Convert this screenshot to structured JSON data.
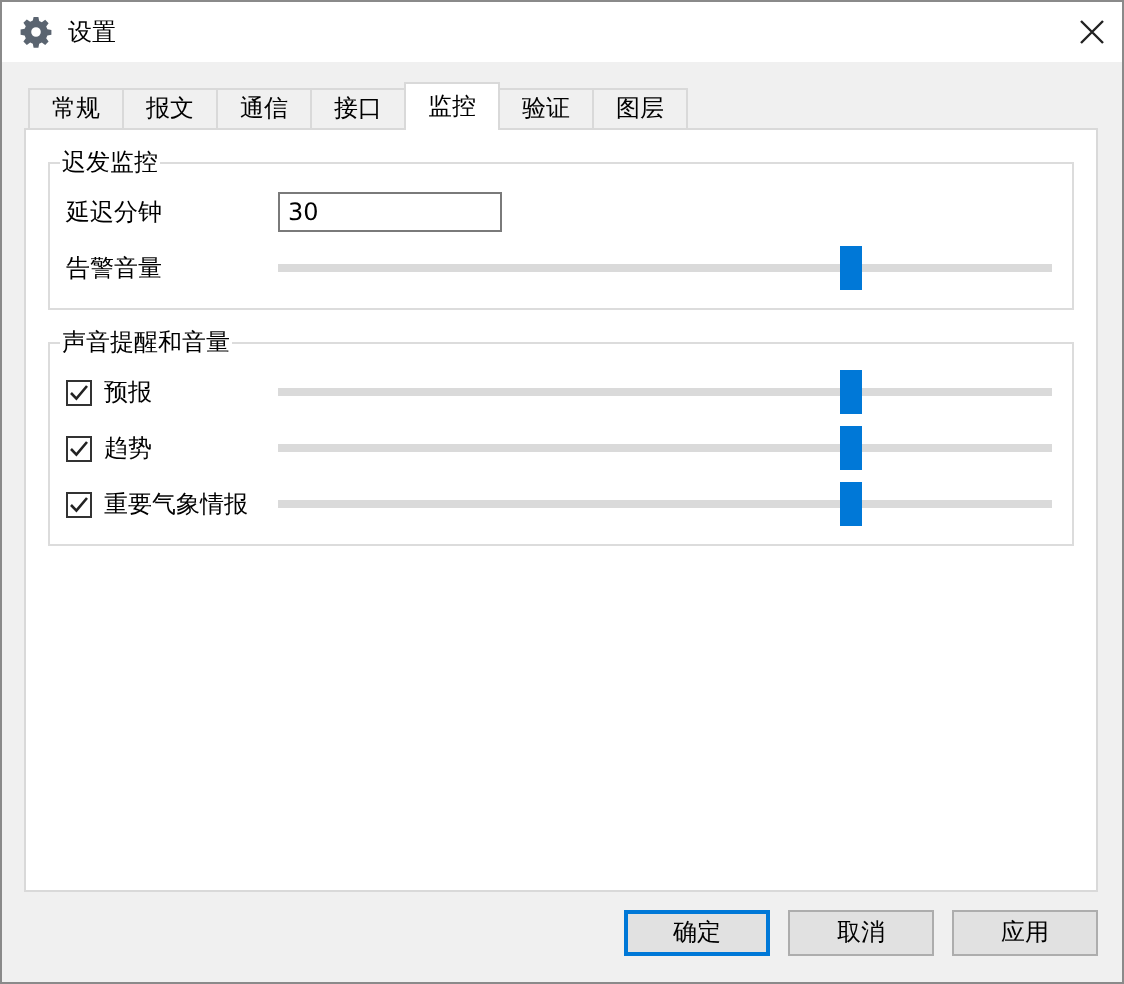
{
  "window": {
    "title": "设置"
  },
  "tabs": [
    {
      "label": "常规",
      "selected": false
    },
    {
      "label": "报文",
      "selected": false
    },
    {
      "label": "通信",
      "selected": false
    },
    {
      "label": "接口",
      "selected": false
    },
    {
      "label": "监控",
      "selected": true
    },
    {
      "label": "验证",
      "selected": false
    },
    {
      "label": "图层",
      "selected": false
    }
  ],
  "delay_group": {
    "title": "迟发监控",
    "delay_label": "延迟分钟",
    "delay_value": "30",
    "alarm": {
      "label": "告警音量",
      "level": 0.74
    }
  },
  "sound_group": {
    "title": "声音提醒和音量",
    "items": [
      {
        "label": "预报",
        "checked": true,
        "level": 0.74
      },
      {
        "label": "趋势",
        "checked": true,
        "level": 0.74
      },
      {
        "label": "重要气象情报",
        "checked": true,
        "level": 0.74
      }
    ]
  },
  "buttons": [
    {
      "label": "确定",
      "default": true
    },
    {
      "label": "取消",
      "default": false
    },
    {
      "label": "应用",
      "default": false
    }
  ]
}
